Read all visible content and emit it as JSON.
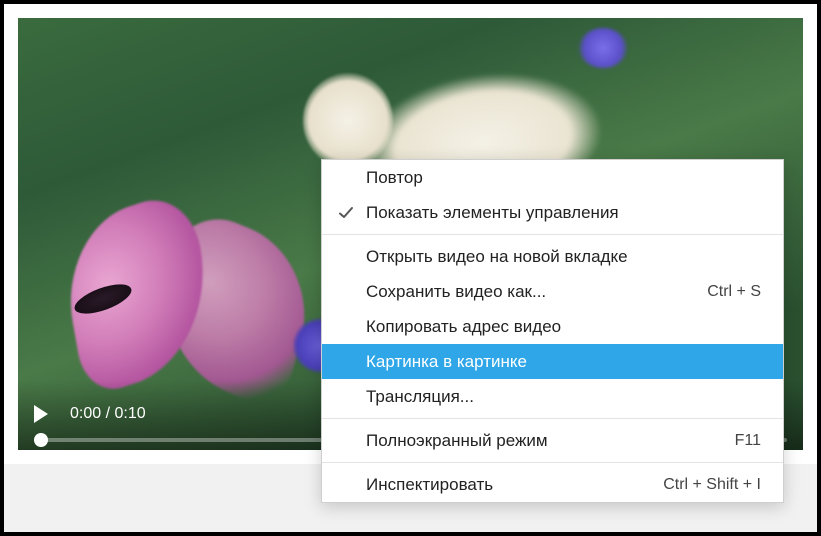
{
  "video": {
    "current_time": "0:00",
    "duration": "0:10",
    "time_display": "0:00 / 0:10"
  },
  "context_menu": {
    "items": [
      {
        "label": "Повтор",
        "shortcut": "",
        "checked": false
      },
      {
        "label": "Показать элементы управления",
        "shortcut": "",
        "checked": true
      },
      {
        "label": "Открыть видео на новой вкладке",
        "shortcut": "",
        "checked": false
      },
      {
        "label": "Сохранить видео как...",
        "shortcut": "Ctrl + S",
        "checked": false
      },
      {
        "label": "Копировать адрес видео",
        "shortcut": "",
        "checked": false
      },
      {
        "label": "Картинка в картинке",
        "shortcut": "",
        "checked": false,
        "highlighted": true
      },
      {
        "label": "Трансляция...",
        "shortcut": "",
        "checked": false
      },
      {
        "label": "Полноэкранный режим",
        "shortcut": "F11",
        "checked": false
      },
      {
        "label": "Инспектировать",
        "shortcut": "Ctrl + Shift + I",
        "checked": false
      }
    ]
  }
}
